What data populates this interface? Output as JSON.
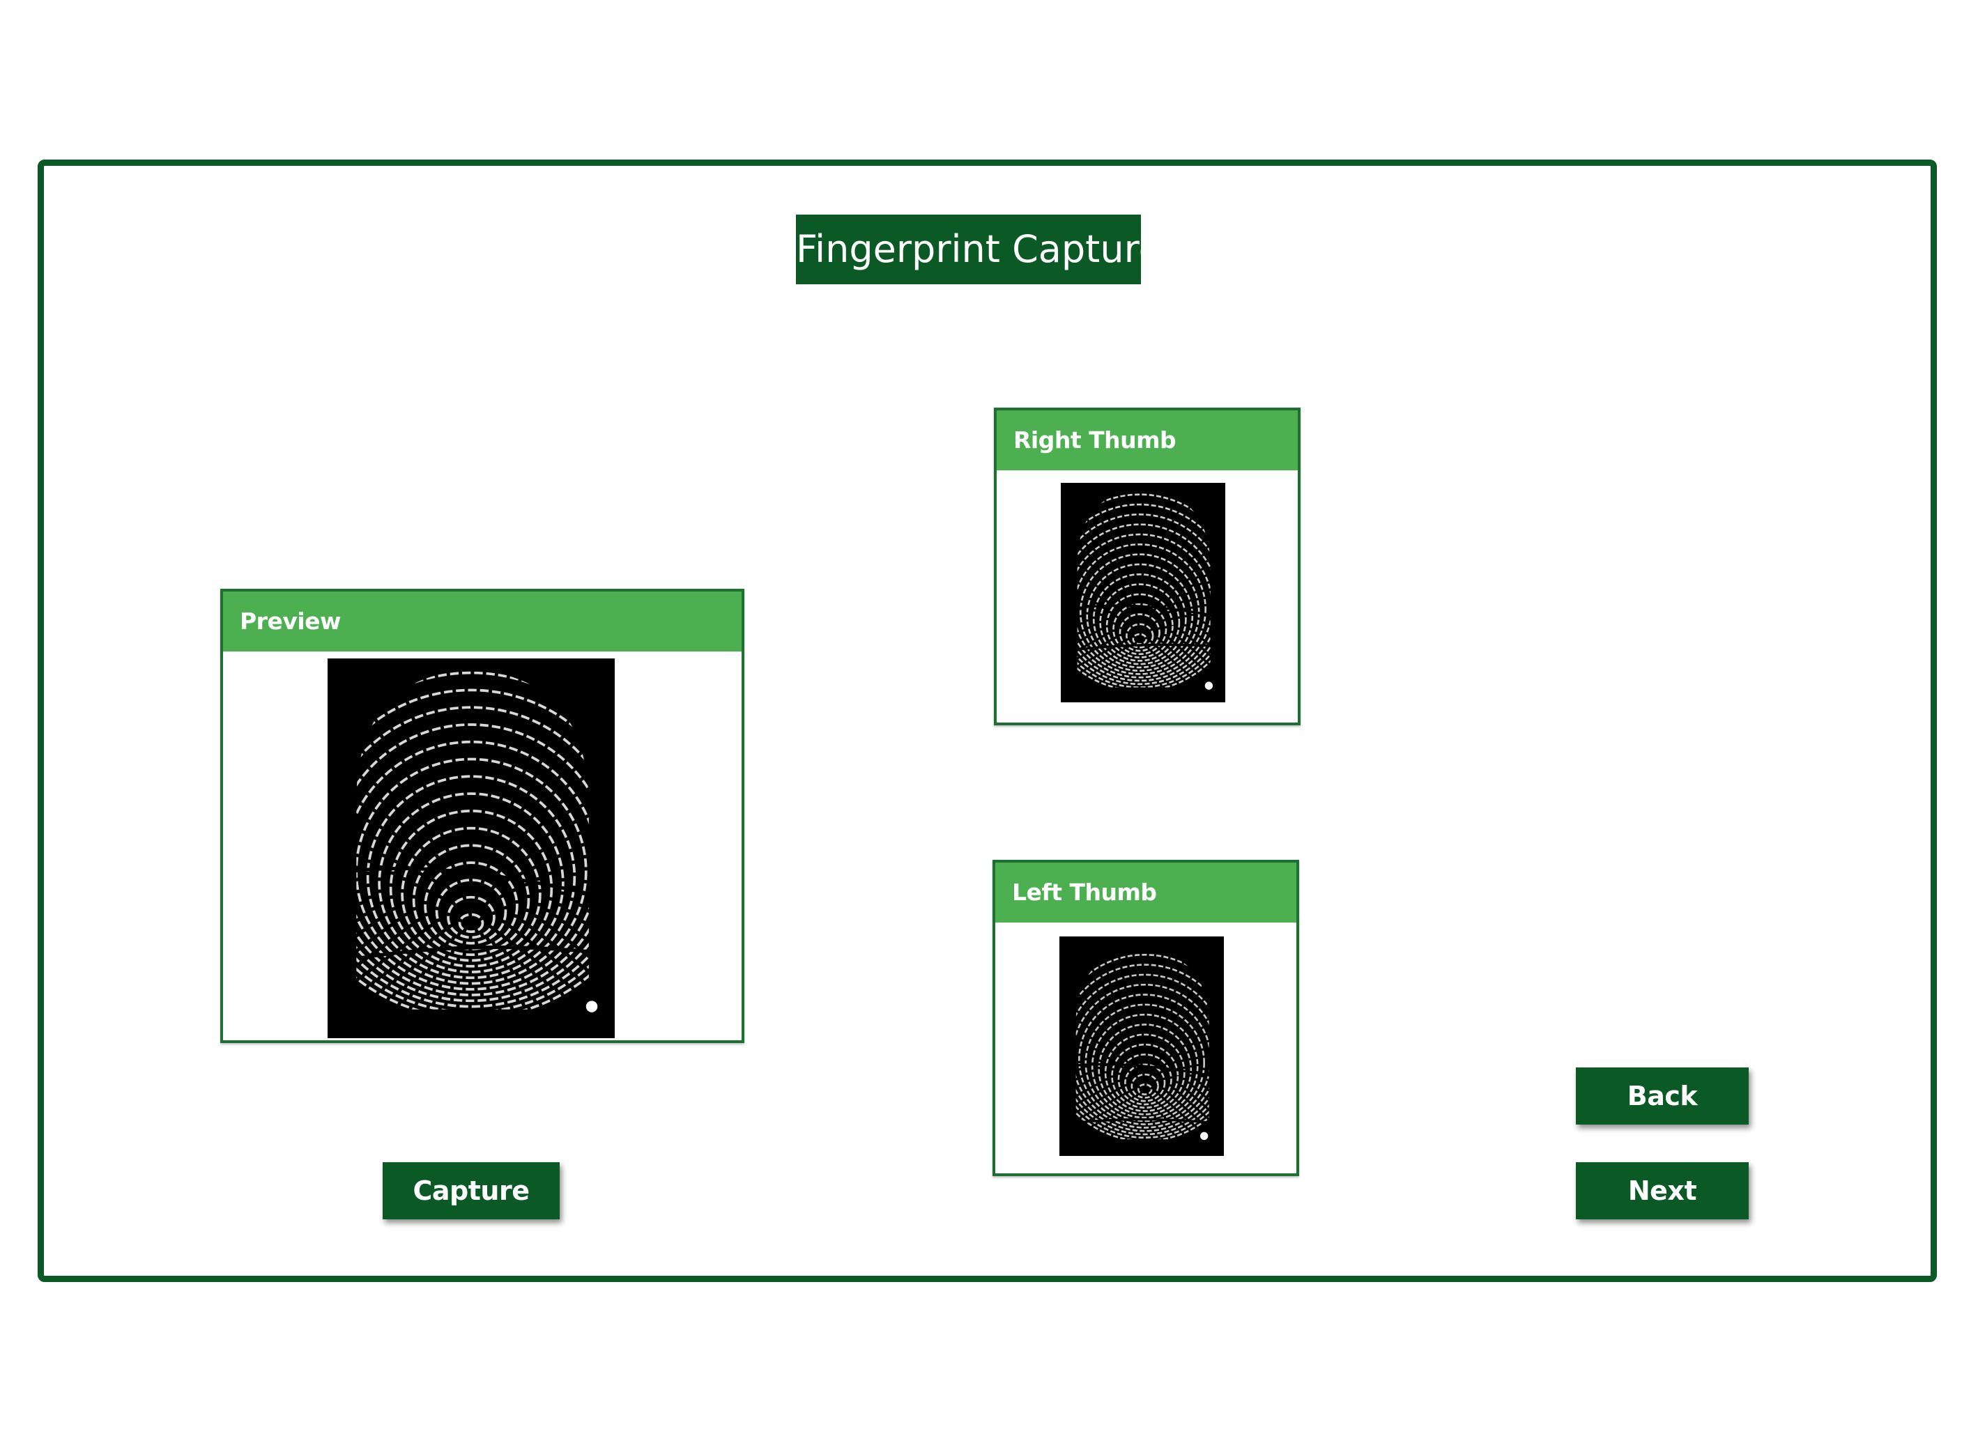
{
  "app": {
    "title": "Fingerprint Capture",
    "accent_color": "#0b5a26",
    "header_color": "#4caf50"
  },
  "panels": {
    "preview": {
      "label": "Preview"
    },
    "right_thumb": {
      "label": "Right Thumb"
    },
    "left_thumb": {
      "label": "Left Thumb"
    }
  },
  "buttons": {
    "capture": "Capture",
    "back": "Back",
    "next": "Next"
  }
}
